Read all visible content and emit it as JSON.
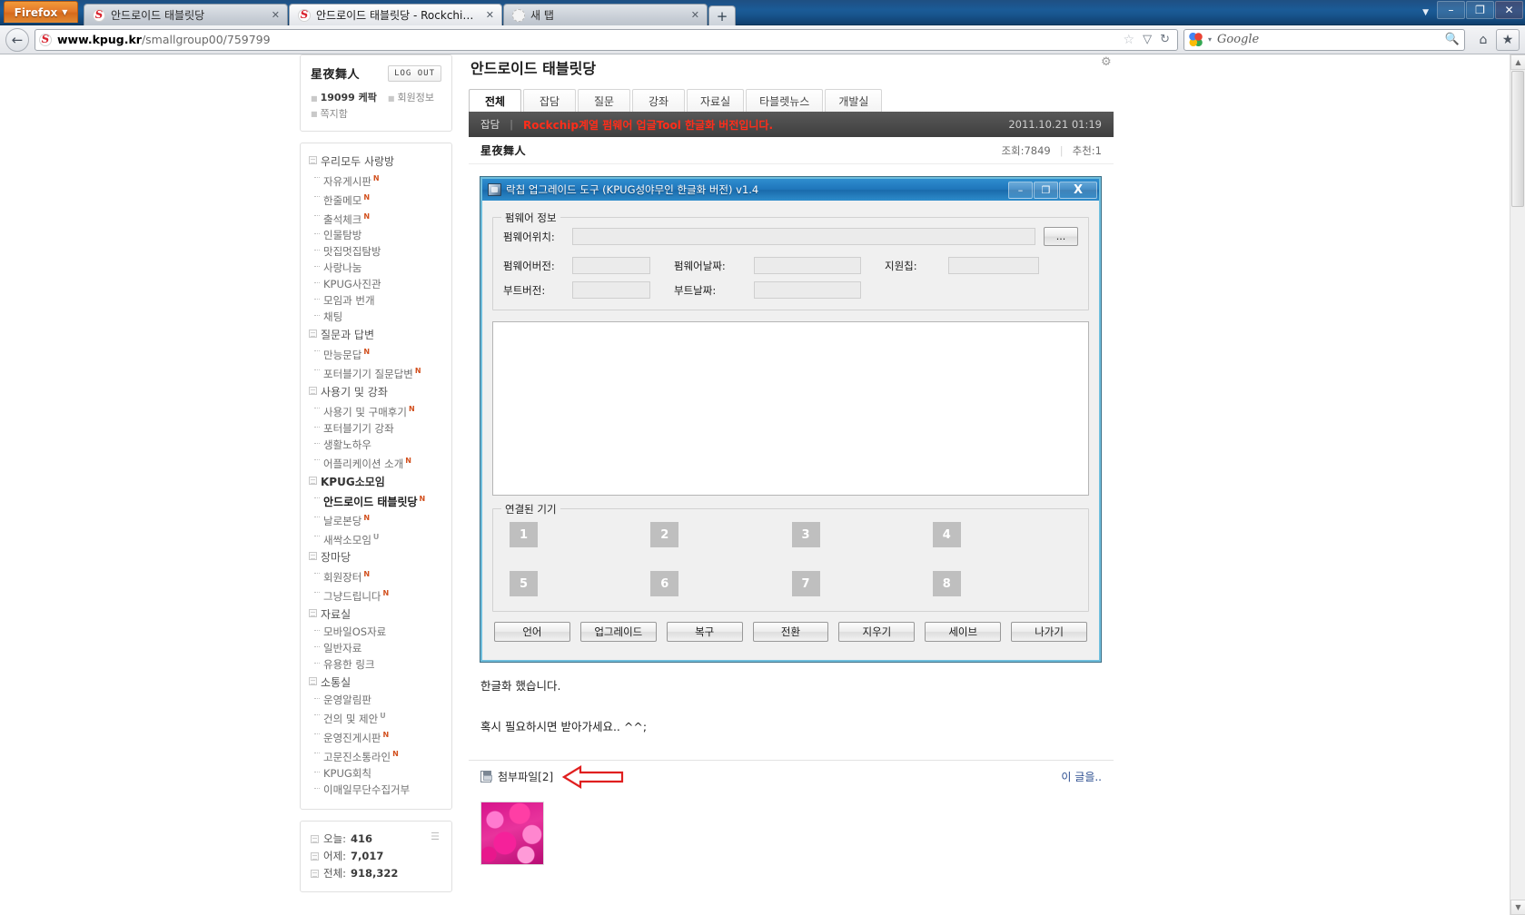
{
  "browser": {
    "firefox_button": "Firefox",
    "tabs": [
      {
        "title": "안드로이드 태블릿당",
        "active": false,
        "favicon": "kpug-favicon"
      },
      {
        "title": "안드로이드 태블릿당 - Rockchip계...",
        "active": true,
        "favicon": "kpug-favicon"
      },
      {
        "title": "새 탭",
        "active": false,
        "favicon": "blank-favicon"
      }
    ],
    "new_tab_label": "+",
    "window_controls": {
      "minimize": "–",
      "maximize": "❐",
      "close": "✕",
      "menu_caret": "▼"
    },
    "url": {
      "scheme_host": "www.kpug.kr",
      "path": "/smallgroup00/759799"
    },
    "search_placeholder": "Google",
    "nav": {
      "back": "←",
      "reload": "↻",
      "star": "☆",
      "dropdown": "▽",
      "home": "⌂",
      "bookmarks": "★"
    }
  },
  "sidebar": {
    "user": {
      "name": "星夜舞人",
      "logout_label": "LOG OUT",
      "credit": "19099 케팍",
      "member_info": "회원정보",
      "message_box": "쪽지함"
    },
    "menu": [
      {
        "type": "category",
        "label": "우리모두 사랑방",
        "bold": false
      },
      {
        "type": "item",
        "label": "자유게시판",
        "flag": "N"
      },
      {
        "type": "item",
        "label": "한줄메모",
        "flag": "N"
      },
      {
        "type": "item",
        "label": "출석체크",
        "flag": "N"
      },
      {
        "type": "item",
        "label": "인물탐방",
        "flag": ""
      },
      {
        "type": "item",
        "label": "맛집멋집탐방",
        "flag": ""
      },
      {
        "type": "item",
        "label": "사랑나눔",
        "flag": ""
      },
      {
        "type": "item",
        "label": "KPUG사진관",
        "flag": ""
      },
      {
        "type": "item",
        "label": "모임과 번개",
        "flag": ""
      },
      {
        "type": "item",
        "label": "채팅",
        "flag": ""
      },
      {
        "type": "category",
        "label": "질문과 답변",
        "bold": false
      },
      {
        "type": "item",
        "label": "만능문답",
        "flag": "N"
      },
      {
        "type": "item",
        "label": "포터블기기 질문답변",
        "flag": "N"
      },
      {
        "type": "category",
        "label": "사용기 및 강좌",
        "bold": false
      },
      {
        "type": "item",
        "label": "사용기 및 구매후기",
        "flag": "N"
      },
      {
        "type": "item",
        "label": "포터블기기 강좌",
        "flag": ""
      },
      {
        "type": "item",
        "label": "생활노하우",
        "flag": ""
      },
      {
        "type": "item",
        "label": "어플리케이션 소개",
        "flag": "N"
      },
      {
        "type": "category",
        "label": "KPUG소모임",
        "bold": true
      },
      {
        "type": "item",
        "label": "안드로이드 태블릿당",
        "flag": "N",
        "current": true
      },
      {
        "type": "item",
        "label": "날로본당",
        "flag": "N"
      },
      {
        "type": "item",
        "label": "새싹소모임",
        "flag": "U"
      },
      {
        "type": "category",
        "label": "장마당",
        "bold": false
      },
      {
        "type": "item",
        "label": "회원장터",
        "flag": "N"
      },
      {
        "type": "item",
        "label": "그냥드립니다",
        "flag": "N"
      },
      {
        "type": "category",
        "label": "자료실",
        "bold": false
      },
      {
        "type": "item",
        "label": "모바일OS자료",
        "flag": ""
      },
      {
        "type": "item",
        "label": "일반자료",
        "flag": ""
      },
      {
        "type": "item",
        "label": "유용한 링크",
        "flag": ""
      },
      {
        "type": "category",
        "label": "소통실",
        "bold": false
      },
      {
        "type": "item",
        "label": "운영알림판",
        "flag": ""
      },
      {
        "type": "item",
        "label": "건의 및 제안",
        "flag": "U"
      },
      {
        "type": "item",
        "label": "운영진게시판",
        "flag": "N"
      },
      {
        "type": "item",
        "label": "고문진소통라인",
        "flag": "N"
      },
      {
        "type": "item",
        "label": "KPUG회칙",
        "flag": ""
      },
      {
        "type": "item",
        "label": "이매일무단수집거부",
        "flag": ""
      }
    ],
    "stats": [
      {
        "label": "오늘:",
        "value": "416"
      },
      {
        "label": "어제:",
        "value": "7,017"
      },
      {
        "label": "전체:",
        "value": "918,322"
      }
    ]
  },
  "main": {
    "board_title": "안드로이드 태블릿당",
    "tabs": [
      {
        "label": "전체",
        "active": true
      },
      {
        "label": "잡담",
        "active": false
      },
      {
        "label": "질문",
        "active": false
      },
      {
        "label": "강좌",
        "active": false
      },
      {
        "label": "자료실",
        "active": false
      },
      {
        "label": "타블렛뉴스",
        "active": false
      },
      {
        "label": "개발실",
        "active": false
      }
    ],
    "post": {
      "category": "잡담",
      "title": "Rockchip계열 펌웨어 업글Tool 한글화 버전입니다.",
      "date": "2011.10.21 01:19",
      "author": "星夜舞人",
      "views": "조회:7849",
      "recommend": "추천:1",
      "body_line1": "한글화 했습니다.",
      "body_line2": "혹시 필요하시면 받아가세요.. ^^;"
    },
    "attachment": {
      "label": "첨부파일[2]",
      "this_post_link": "이 글을..",
      "arrow": "red-left-arrow"
    }
  },
  "app_window": {
    "title": "락칩 업그레이드 도구 (KPUG성야무인 한글화 버전) v1.4",
    "window_controls": {
      "minimize": "–",
      "maximize": "❐",
      "close": "X"
    },
    "firmware_group_legend": "펌웨어 정보",
    "fields": [
      {
        "label": "펌웨어위치:",
        "value": ""
      },
      {
        "label": "펌웨어버전:",
        "value": ""
      },
      {
        "label": "펌웨어날짜:",
        "value": ""
      },
      {
        "label": "지원칩:",
        "value": ""
      },
      {
        "label": "부트버전:",
        "value": ""
      },
      {
        "label": "부트날짜:",
        "value": ""
      }
    ],
    "browse_button": "...",
    "log_text": "",
    "device_group_legend": "연결된 기기",
    "devices": [
      "1",
      "2",
      "3",
      "4",
      "5",
      "6",
      "7",
      "8"
    ],
    "buttons": [
      "언어",
      "업그레이드",
      "복구",
      "전환",
      "지우기",
      "세이브",
      "나가기"
    ]
  },
  "colors": {
    "title_blue": "#1f76bb",
    "post_title_red": "#ff2d1a",
    "arrow_red": "#e01f1f",
    "accent_orange": "#e4792a",
    "flag_new": "#d2501e"
  }
}
